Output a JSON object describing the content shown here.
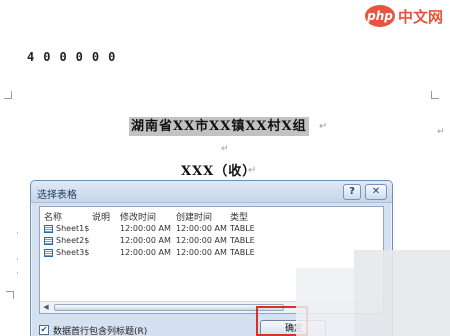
{
  "watermark": {
    "logo": "php",
    "text": "中文网"
  },
  "document": {
    "code_line": "400000",
    "heading": "湖南省XX市XX镇XX村X组",
    "subtitle": "XXX（收）",
    "paragraph_mark": "↵"
  },
  "dialog": {
    "title": "选择表格",
    "help_label": "?",
    "close_label": "✕",
    "columns": {
      "name": "名称",
      "desc": "说明",
      "modified": "修改时间",
      "created": "创建时间",
      "type": "类型"
    },
    "rows": [
      {
        "name": "Sheet1$",
        "modified": "12:00:00 AM",
        "created": "12:00:00 AM",
        "type": "TABLE"
      },
      {
        "name": "Sheet2$",
        "modified": "12:00:00 AM",
        "created": "12:00:00 AM",
        "type": "TABLE"
      },
      {
        "name": "Sheet3$",
        "modified": "12:00:00 AM",
        "created": "12:00:00 AM",
        "type": "TABLE"
      }
    ],
    "scroll_left": "◀",
    "first_row_header_label": "数据首行包含列标题(R)",
    "first_row_header_checked": "✔",
    "ok_label": "确定"
  },
  "colors": {
    "highlight": "#d6322c",
    "brand": "#e8543f",
    "dialog_bg": "#d5e1f0"
  }
}
